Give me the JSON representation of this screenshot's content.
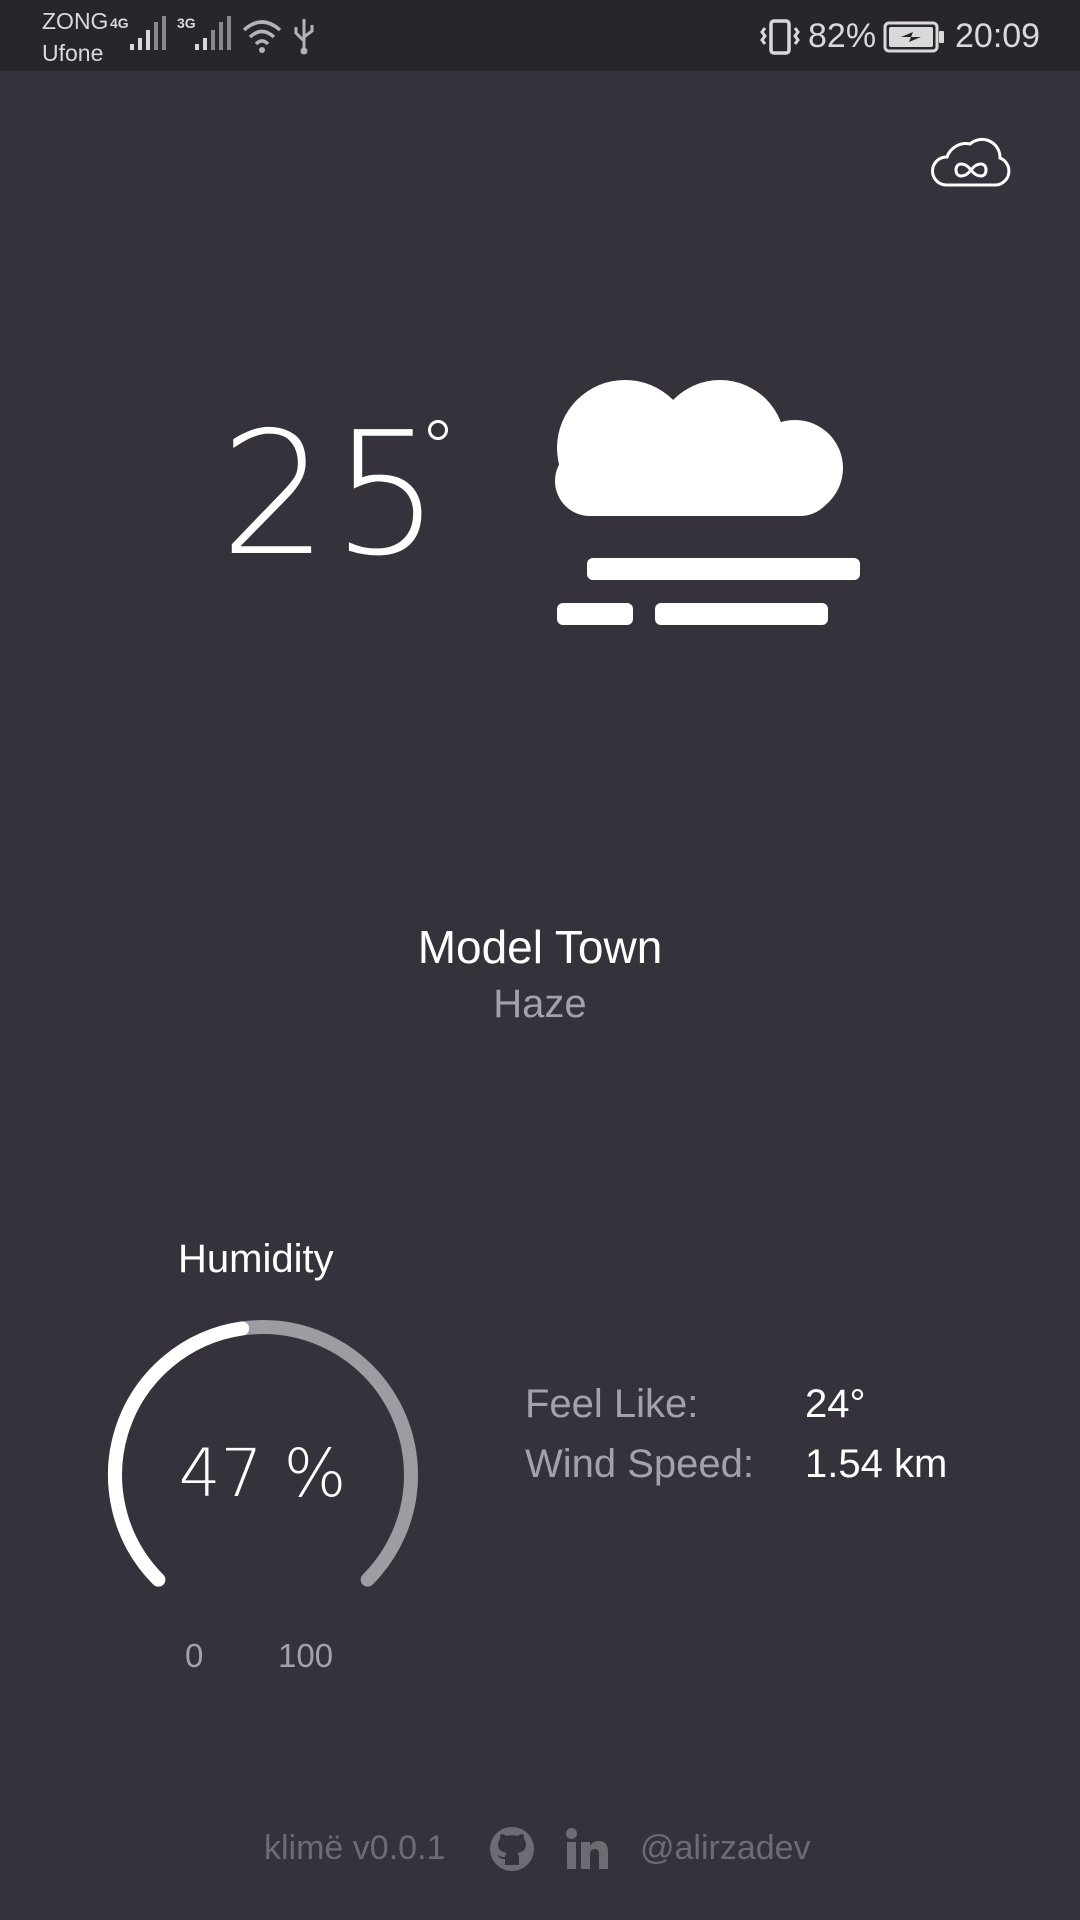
{
  "status_bar": {
    "carrier_1": "ZONG",
    "carrier_2": "Ufone",
    "network_1": "4G",
    "network_2": "3G",
    "battery": "82%",
    "time": "20:09",
    "icons": [
      "signal-icon",
      "wifi-icon",
      "usb-icon",
      "vibrate-icon",
      "battery-charging-icon"
    ]
  },
  "header": {
    "app_icon": "cloud-infinity-icon"
  },
  "current": {
    "temperature": "25",
    "condition_icon": "haze-icon",
    "city": "Model Town",
    "condition": "Haze"
  },
  "humidity": {
    "title": "Humidity",
    "value": 47,
    "display": "47 %",
    "min_label": "0",
    "max_label": "100",
    "colors": {
      "track": "#9e9ca2",
      "fill": "#ffffff"
    }
  },
  "stats": [
    {
      "label": "Feel Like:",
      "value": "24°"
    },
    {
      "label": "Wind Speed:",
      "value": "1.54 km"
    }
  ],
  "footer": {
    "name": "klimë v0.0.1",
    "icons": [
      "github-icon",
      "linkedin-icon"
    ],
    "handle": "@alirzadev"
  },
  "colors": {
    "background": "#35323b",
    "status_bar": "#28262c",
    "muted_text": "#a4a2a8"
  }
}
